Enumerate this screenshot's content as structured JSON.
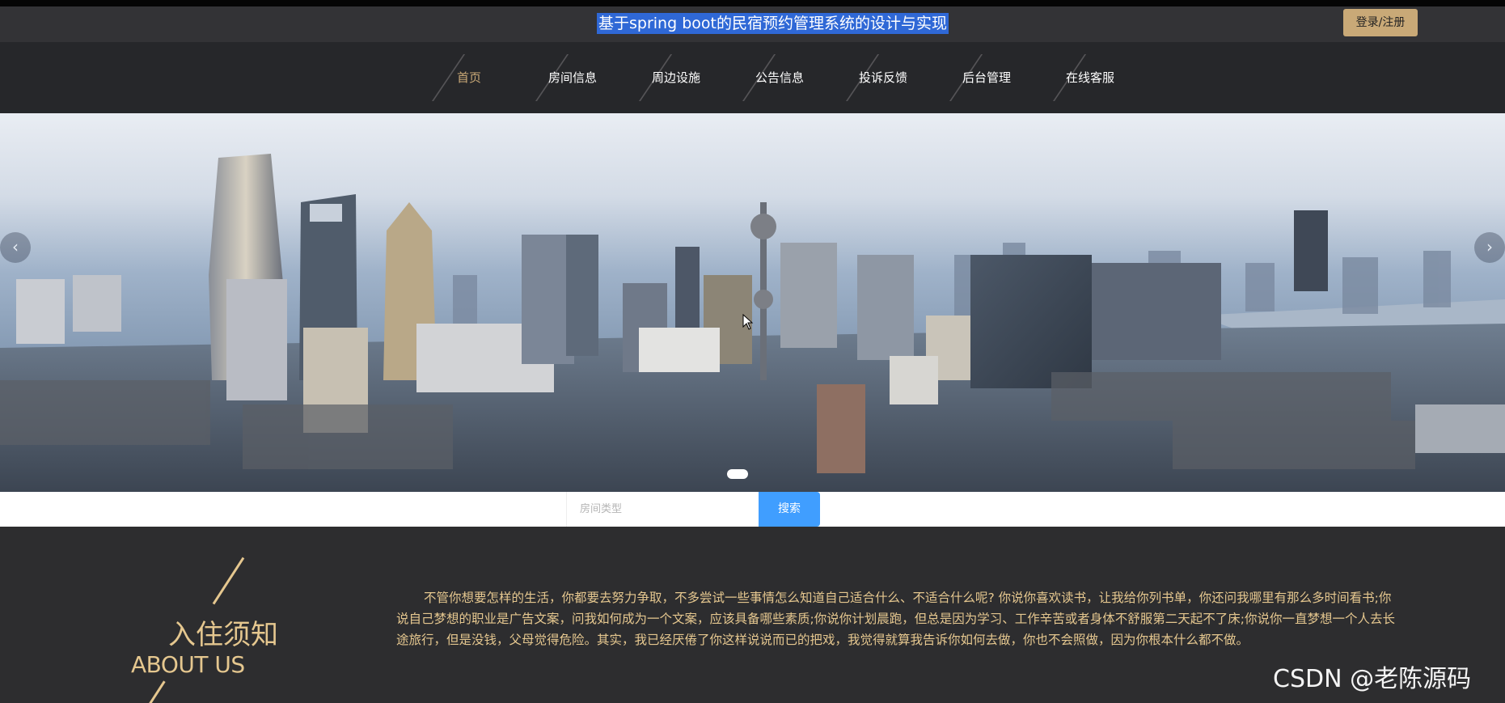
{
  "header": {
    "site_title": "基于spring boot的民宿预约管理系统的设计与实现",
    "login_label": "登录/注册"
  },
  "nav": {
    "items": [
      {
        "label": "首页",
        "active": true
      },
      {
        "label": "房间信息",
        "active": false
      },
      {
        "label": "周边设施",
        "active": false
      },
      {
        "label": "公告信息",
        "active": false
      },
      {
        "label": "投诉反馈",
        "active": false
      },
      {
        "label": "后台管理",
        "active": false
      },
      {
        "label": "在线客服",
        "active": false
      }
    ]
  },
  "banner": {
    "prev_icon": "chevron-left-icon",
    "next_icon": "chevron-right-icon",
    "prev_glyph": "‹",
    "next_glyph": "›",
    "slide_count": 1,
    "active_slide": 1
  },
  "search": {
    "placeholder": "房间类型",
    "value": "",
    "button_label": "搜索"
  },
  "about": {
    "title": "入住须知",
    "subtitle": "ABOUT US",
    "text": "不管你想要怎样的生活，你都要去努力争取，不多尝试一些事情怎么知道自己适合什么、不适合什么呢? 你说你喜欢读书，让我给你列书单，你还问我哪里有那么多时间看书;你说自己梦想的职业是广告文案，问我如何成为一个文案，应该具备哪些素质;你说你计划晨跑，但总是因为学习、工作辛苦或者身体不舒服第二天起不了床;你说你一直梦想一个人去长途旅行，但是没钱，父母觉得危险。其实，我已经厌倦了你这样说说而已的把戏，我觉得就算我告诉你如何去做，你也不会照做，因为你根本什么都不做。"
  },
  "watermark": "CSDN @老陈源码",
  "colors": {
    "accent_gold": "#c9a977",
    "about_text": "#e5c78f",
    "search_button": "#409eff",
    "title_highlight": "#2f68d6",
    "nav_bg": "#26272a"
  }
}
